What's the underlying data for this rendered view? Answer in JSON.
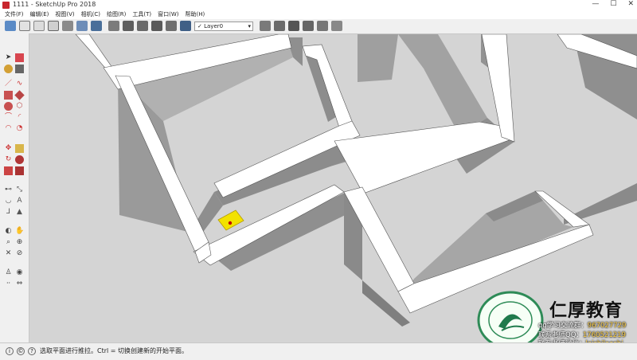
{
  "window": {
    "title": "1111 - SketchUp Pro 2018",
    "controls": [
      "—",
      "☐",
      "✕"
    ]
  },
  "menu": [
    "文件(F)",
    "编辑(E)",
    "视图(V)",
    "相机(C)",
    "绘图(R)",
    "工具(T)",
    "窗口(W)",
    "帮助(H)"
  ],
  "toolbar": {
    "layer_selected": "Layer0",
    "layer_checkmark": "✓"
  },
  "statusbar": {
    "message": "选取平面进行推拉。Ctrl = 切换创建新的开始平面。"
  },
  "watermark": {
    "brand": "仁厚教育",
    "lines": [
      {
        "label": "qq学习交流群：",
        "value": "967027729"
      },
      {
        "label": "联系老师QQ：",
        "value": "1760521219"
      },
      {
        "label": "联系老师微信：",
        "value": "leishilaoshi"
      }
    ]
  },
  "colors": {
    "wall_top": "#ffffff",
    "wall_side": "#9c9c9c",
    "floor": "#d4d4d4",
    "highlight": "#f2e200"
  }
}
